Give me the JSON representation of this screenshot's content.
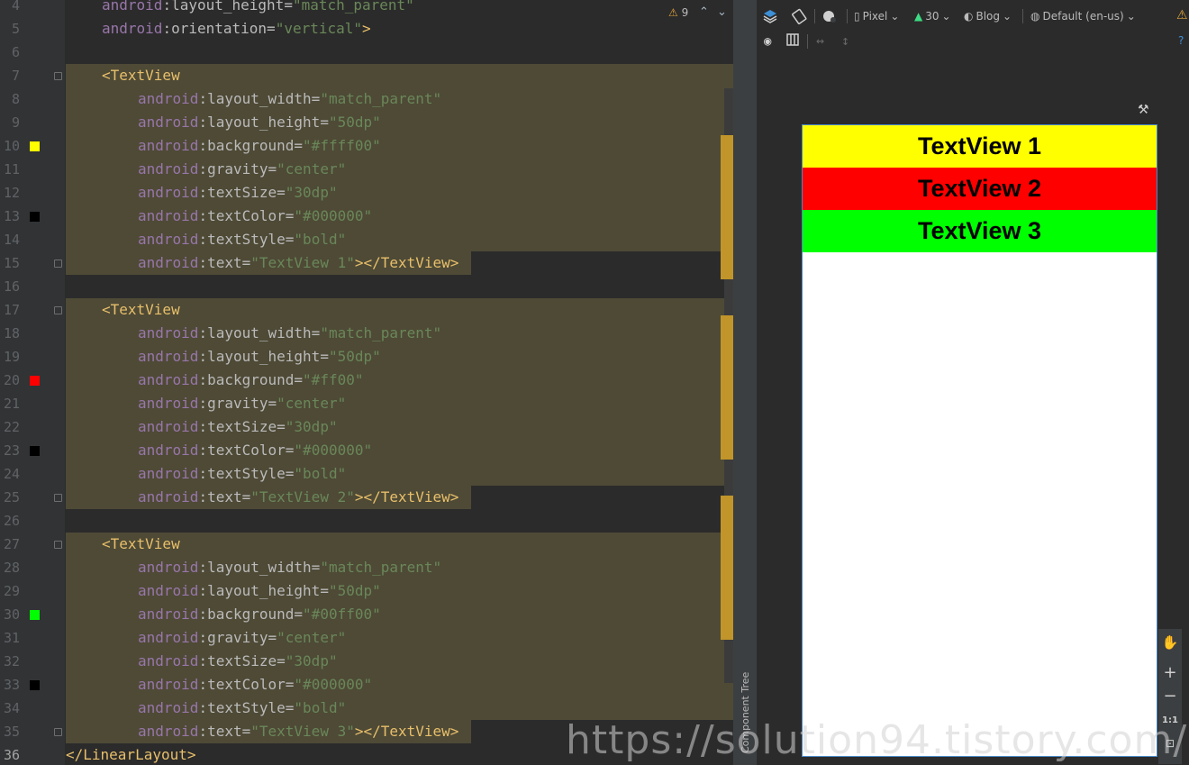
{
  "editor": {
    "line_numbers": [
      "4",
      "5",
      "6",
      "7",
      "8",
      "9",
      "10",
      "11",
      "12",
      "13",
      "14",
      "15",
      "16",
      "17",
      "18",
      "19",
      "20",
      "21",
      "22",
      "23",
      "24",
      "25",
      "26",
      "27",
      "28",
      "29",
      "30",
      "31",
      "32",
      "33",
      "34",
      "35",
      "36"
    ],
    "inspection": {
      "warning_icon": "warning-icon",
      "count": "9"
    },
    "swatch_colors": {
      "yellow": "#ffff00",
      "red": "#ff0000",
      "black": "#000000",
      "green": "#00ff00"
    }
  },
  "code": {
    "l4": {
      "ns": "android",
      "attr": "layout_height",
      "val": "\"match_parent\""
    },
    "l5": {
      "ns": "android",
      "attr": "orientation",
      "val": "\"vertical\"",
      "tail": ">"
    },
    "tv_open": "<TextView",
    "tv_close": "></TextView>",
    "ll_close": "</LinearLayout>",
    "block1": [
      {
        "ns": "android",
        "attr": "layout_width",
        "val": "\"match_parent\""
      },
      {
        "ns": "android",
        "attr": "layout_height",
        "val": "\"50dp\""
      },
      {
        "ns": "android",
        "attr": "background",
        "val": "\"#ffff00\""
      },
      {
        "ns": "android",
        "attr": "gravity",
        "val": "\"center\""
      },
      {
        "ns": "android",
        "attr": "textSize",
        "val": "\"30dp\""
      },
      {
        "ns": "android",
        "attr": "textColor",
        "val": "\"#000000\""
      },
      {
        "ns": "android",
        "attr": "textStyle",
        "val": "\"bold\""
      },
      {
        "ns": "android",
        "attr": "text",
        "val": "\"TextView 1\""
      }
    ],
    "block2": [
      {
        "ns": "android",
        "attr": "layout_width",
        "val": "\"match_parent\""
      },
      {
        "ns": "android",
        "attr": "layout_height",
        "val": "\"50dp\""
      },
      {
        "ns": "android",
        "attr": "background",
        "val": "\"#ff00\""
      },
      {
        "ns": "android",
        "attr": "gravity",
        "val": "\"center\""
      },
      {
        "ns": "android",
        "attr": "textSize",
        "val": "\"30dp\""
      },
      {
        "ns": "android",
        "attr": "textColor",
        "val": "\"#000000\""
      },
      {
        "ns": "android",
        "attr": "textStyle",
        "val": "\"bold\""
      },
      {
        "ns": "android",
        "attr": "text",
        "val": "\"TextView 2\""
      }
    ],
    "block3": [
      {
        "ns": "android",
        "attr": "layout_width",
        "val": "\"match_parent\""
      },
      {
        "ns": "android",
        "attr": "layout_height",
        "val": "\"50dp\""
      },
      {
        "ns": "android",
        "attr": "background",
        "val": "\"#00ff00\""
      },
      {
        "ns": "android",
        "attr": "gravity",
        "val": "\"center\""
      },
      {
        "ns": "android",
        "attr": "textSize",
        "val": "\"30dp\""
      },
      {
        "ns": "android",
        "attr": "textColor",
        "val": "\"#000000\""
      },
      {
        "ns": "android",
        "attr": "textStyle",
        "val": "\"bold\""
      },
      {
        "ns": "android",
        "attr": "text",
        "val": "\"TextView 3\""
      }
    ]
  },
  "toolbar": {
    "device": "Pixel",
    "api": "30",
    "theme": "Blog",
    "locale": "Default (en-us)"
  },
  "preview": {
    "tv1": "TextView 1",
    "tv2": "TextView 2",
    "tv3": "TextView 3",
    "colors": {
      "tv1": "#ffff00",
      "tv2": "#ff0000",
      "tv3": "#00ff00"
    }
  },
  "side_tab": "Component Tree",
  "zoom": {
    "plus": "+",
    "minus": "−",
    "one_to_one": "1:1"
  },
  "watermark": "https://solution94.tistory.com/"
}
